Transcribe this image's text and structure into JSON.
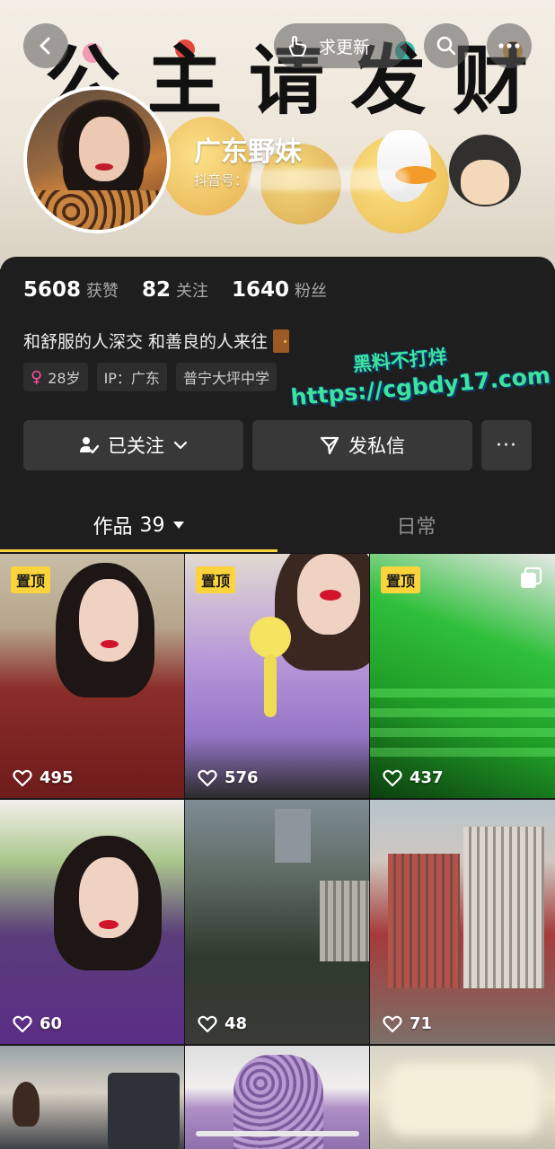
{
  "header": {
    "banner_title_chars": [
      "公",
      "主",
      "请",
      "发",
      "财"
    ],
    "update_request_label": "求更新",
    "nickname": "广东野妹",
    "douyin_id_label": "抖音号："
  },
  "stats": [
    {
      "value": "5608",
      "label": "获赞"
    },
    {
      "value": "82",
      "label": "关注"
    },
    {
      "value": "1640",
      "label": "粉丝"
    }
  ],
  "bio": "和舒服的人深交  和善良的人来往",
  "tags": {
    "age": "28岁",
    "ip": "IP：广东",
    "school": "普宁大坪中学"
  },
  "watermark": {
    "line1": "黑料不打烊",
    "line2": "https://cgbdy17.com"
  },
  "actions": {
    "follow_label": "已关注",
    "message_label": "发私信",
    "more_label": "···"
  },
  "tabs": {
    "works_label": "作品",
    "works_count": "39",
    "daily_label": "日常"
  },
  "videos": [
    {
      "pinned": "置顶",
      "likes": "495"
    },
    {
      "pinned": "置顶",
      "likes": "576"
    },
    {
      "pinned": "置顶",
      "likes": "437"
    },
    {
      "pinned": "",
      "likes": "60"
    },
    {
      "pinned": "",
      "likes": "48"
    },
    {
      "pinned": "",
      "likes": "71"
    }
  ],
  "colors": {
    "accent": "#fbd43c",
    "background": "#161616",
    "card": "#1e1e1e",
    "button": "#383838",
    "watermark": "#3ee39b",
    "gender": "#ff4fa3"
  },
  "icons": [
    "back-icon",
    "hand-icon",
    "search-icon",
    "more-icon",
    "follow-check-icon",
    "chevron-down-icon",
    "send-icon",
    "heart-icon",
    "multi-image-icon",
    "female-icon",
    "door-icon"
  ]
}
